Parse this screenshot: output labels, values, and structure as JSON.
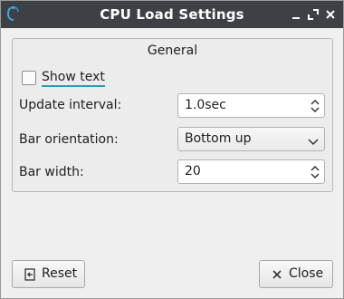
{
  "window": {
    "title": "CPU Load Settings",
    "icons": {
      "app": "cpu-load-app-icon",
      "minimize": "minimize-icon",
      "maximize": "maximize-icon",
      "close": "close-icon"
    }
  },
  "group": {
    "title": "General",
    "show_text": {
      "label": "Show text",
      "checked": false
    },
    "update_interval": {
      "label": "Update interval:",
      "value": "1.0sec"
    },
    "bar_orientation": {
      "label": "Bar orientation:",
      "value": "Bottom up"
    },
    "bar_width": {
      "label": "Bar width:",
      "value": "20"
    }
  },
  "buttons": {
    "reset": {
      "label": "Reset",
      "icon": "reset-icon"
    },
    "close": {
      "label": "Close",
      "icon": "close-x-icon"
    }
  },
  "colors": {
    "titlebar": "#3d4146",
    "focus_underline": "#2a9bb5"
  }
}
